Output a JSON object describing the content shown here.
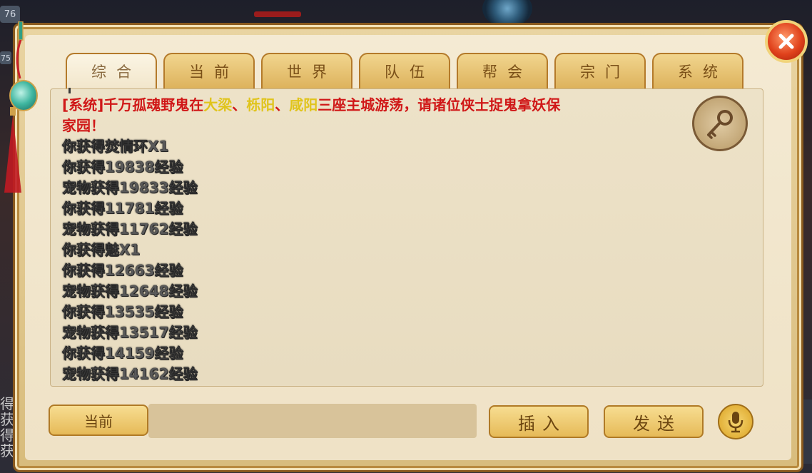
{
  "background": {
    "badge_top": "76",
    "badge_mid": "75",
    "side_text": "得获得获"
  },
  "tabs": [
    {
      "label": "综合",
      "active": true
    },
    {
      "label": "当前",
      "active": false
    },
    {
      "label": "世界",
      "active": false
    },
    {
      "label": "队伍",
      "active": false
    },
    {
      "label": "帮会",
      "active": false
    },
    {
      "label": "宗门",
      "active": false
    },
    {
      "label": "系统",
      "active": false
    }
  ],
  "chat": {
    "system_message": {
      "prefix": "[系统]千万孤魂野鬼在",
      "city1": "大梁",
      "sep1": "、",
      "city2": "栎阳",
      "sep2": "、",
      "city3": "咸阳",
      "suffix": "三座主城游荡，请诸位侠士捉鬼拿妖保",
      "line2": "家园！"
    },
    "lines": [
      "你获得焚情环X1",
      "你获得19838经验",
      "宠物获得19833经验",
      "你获得11781经验",
      "宠物获得11762经验",
      "你获得魅X1",
      "你获得12663经验",
      "宠物获得12648经验",
      "你获得13535经验",
      "宠物获得13517经验",
      "你获得14159经验",
      "宠物获得14162经验"
    ]
  },
  "footer": {
    "channel_label": "当前",
    "input_value": "",
    "insert_label": "插入",
    "send_label": "发送"
  },
  "icons": {
    "key": "key-icon",
    "mic": "microphone-icon",
    "close": "close-icon"
  },
  "colors": {
    "system_text": "#d01818",
    "city_highlight": "#e0c41c",
    "button_gold": "#e6ba58",
    "close_red": "#e0421c"
  }
}
